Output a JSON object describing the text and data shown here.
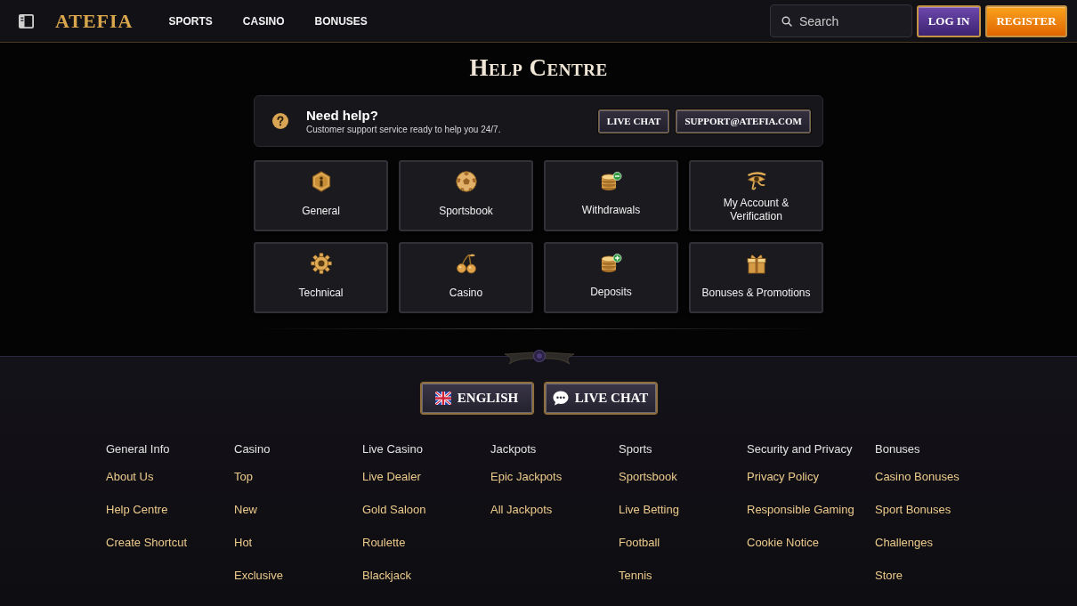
{
  "header": {
    "logo": "ATEFIA",
    "nav": [
      "SPORTS",
      "CASINO",
      "BONUSES"
    ],
    "search": {
      "placeholder": "Search"
    },
    "buttons": [
      {
        "label": "LOG IN",
        "kind": "login"
      },
      {
        "label": "REGISTER",
        "kind": "register"
      }
    ]
  },
  "page_title": "Help Centre",
  "help_banner": {
    "title": "Need help?",
    "subtitle": "Customer support service ready to help you 24/7.",
    "buttons": [
      "LIVE CHAT",
      "SUPPORT@ATEFIA.COM"
    ]
  },
  "categories": [
    "General",
    "Sportsbook",
    "Withdrawals",
    "My Account & Verification",
    "Technical",
    "Casino",
    "Deposits",
    "Bonuses & Promotions"
  ],
  "footer": {
    "buttons": [
      {
        "label": "ENGLISH",
        "kind": "language"
      },
      {
        "label": "LIVE CHAT",
        "kind": "chat"
      }
    ],
    "columns": [
      {
        "heading": "General Info",
        "links": [
          "About Us",
          "Help Centre",
          "Create Shortcut"
        ]
      },
      {
        "heading": "Casino",
        "links": [
          "Top",
          "New",
          "Hot",
          "Exclusive"
        ]
      },
      {
        "heading": "Live Casino",
        "links": [
          "Live Dealer",
          "Gold Saloon",
          "Roulette",
          "Blackjack"
        ]
      },
      {
        "heading": "Jackpots",
        "links": [
          "Epic Jackpots",
          "All Jackpots"
        ]
      },
      {
        "heading": "Sports",
        "links": [
          "Sportsbook",
          "Live Betting",
          "Football",
          "Tennis"
        ]
      },
      {
        "heading": "Security and Privacy",
        "links": [
          "Privacy Policy",
          "Responsible Gaming",
          "Cookie Notice"
        ]
      },
      {
        "heading": "Bonuses",
        "links": [
          "Casino Bonuses",
          "Sport Bonuses",
          "Challenges",
          "Store"
        ]
      }
    ]
  }
}
